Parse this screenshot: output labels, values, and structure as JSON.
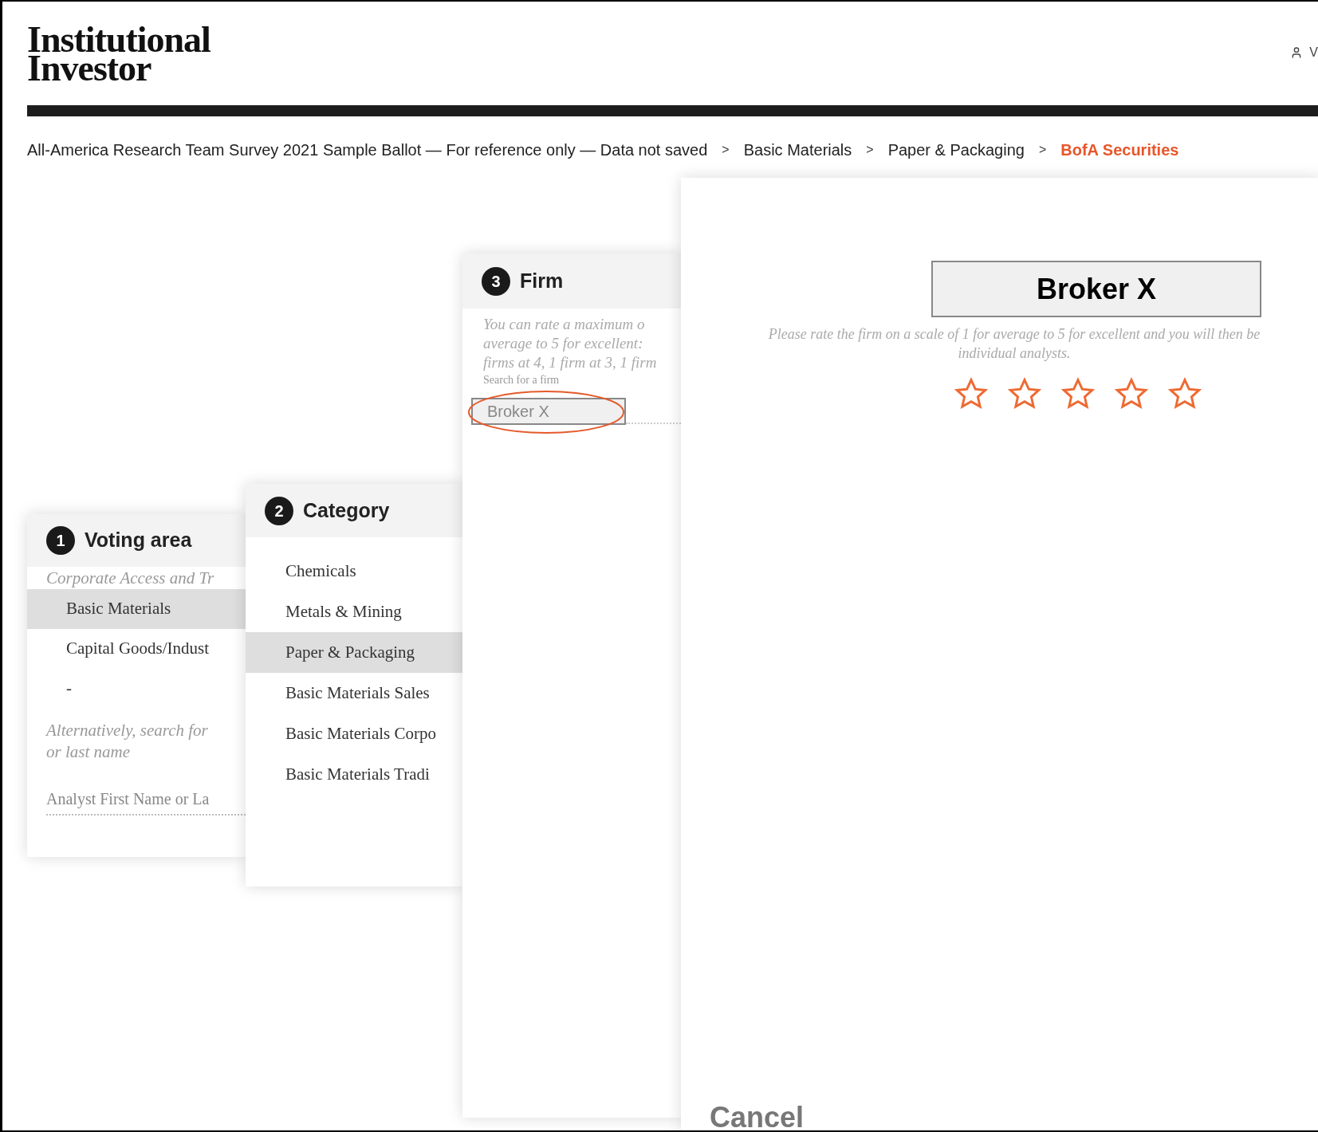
{
  "header": {
    "logo": [
      "Institutional",
      "Investor"
    ],
    "account_label": "V"
  },
  "breadcrumb": [
    {
      "kind": "crumb",
      "text": "All-America Research Team Survey 2021 Sample Ballot — For reference only — Data not saved",
      "current": false
    },
    {
      "kind": "separator",
      "text": ">"
    },
    {
      "kind": "crumb",
      "text": "Basic Materials",
      "current": false
    },
    {
      "kind": "separator",
      "text": ">"
    },
    {
      "kind": "crumb",
      "text": "Paper & Packaging",
      "current": false
    },
    {
      "kind": "separator",
      "text": ">"
    },
    {
      "kind": "crumb",
      "text": "BofA Securities",
      "current": true
    }
  ],
  "voting_panel": {
    "step": "1",
    "title": "Voting area",
    "group_label": "Corporate Access and Tr",
    "items": [
      {
        "label": "Basic Materials",
        "selected": true
      },
      {
        "label": "Capital Goods/Indust",
        "selected": false
      },
      {
        "label": "-",
        "selected": false
      }
    ],
    "search_hint": [
      "Alternatively, search for",
      "or last name"
    ],
    "search_placeholder": "Analyst First Name or La"
  },
  "category_panel": {
    "step": "2",
    "title": "Category",
    "items": [
      {
        "label": "Chemicals",
        "selected": false
      },
      {
        "label": "Metals & Mining",
        "selected": false
      },
      {
        "label": "Paper & Packaging",
        "selected": true
      },
      {
        "label": "Basic Materials Sales",
        "selected": false
      },
      {
        "label": "Basic Materials Corpo",
        "selected": false
      },
      {
        "label": "Basic Materials Tradi",
        "selected": false
      }
    ]
  },
  "firm_panel": {
    "step": "3",
    "title": "Firm",
    "description": [
      "You can rate a maximum o",
      "average to 5 for excellent:",
      "firms at 4, 1 firm at 3, 1 firm"
    ],
    "search_label": "Search for a firm",
    "search_value": "Broker X",
    "highlighted": true
  },
  "rating_panel": {
    "firm_name": "Broker X",
    "description": [
      "Please rate the firm on a scale of 1 for average to 5 for excellent and you will then be",
      "individual analysts."
    ],
    "stars": 0,
    "cancel": "Cancel"
  }
}
